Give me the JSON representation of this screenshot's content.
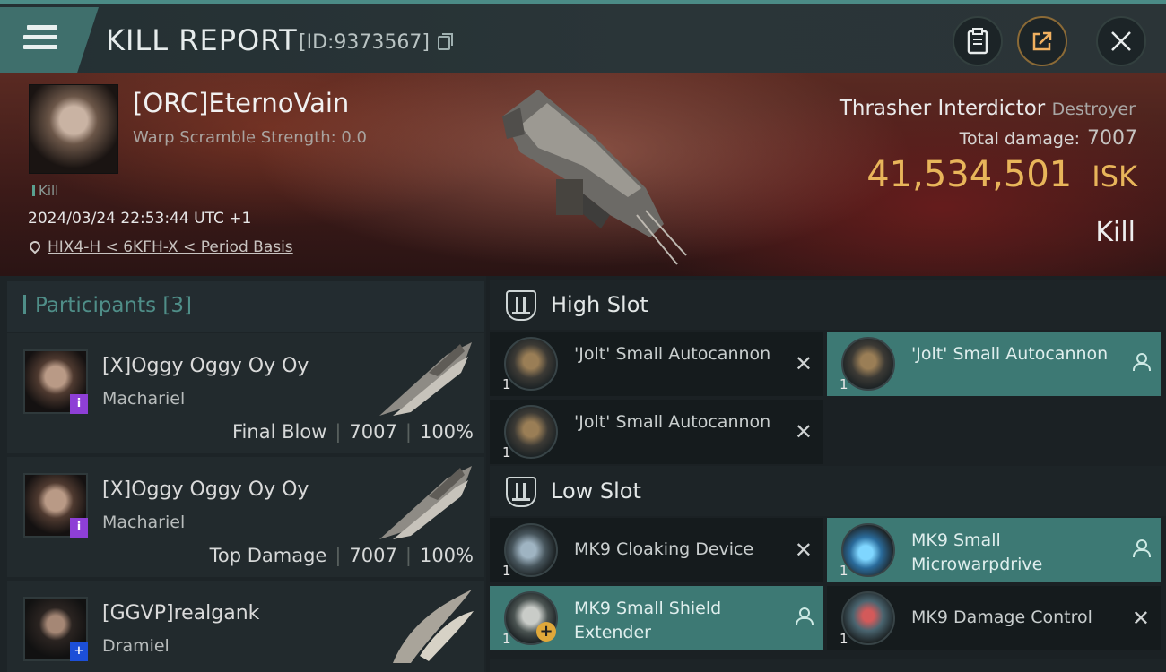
{
  "header": {
    "title": "KILL REPORT",
    "id_label": "[ID:9373567]",
    "icons": [
      "menu-icon",
      "copy-icon",
      "clipboard-icon",
      "share-icon",
      "close-icon"
    ]
  },
  "victim": {
    "pilot_name": "[ORC]EternoVain",
    "warp_scramble": "Warp Scramble Strength: 0.0",
    "kill_tag": "Kill",
    "datetime": "2024/03/24 22:53:44 UTC +1",
    "location": "HIX4-H < 6KFH-X < Period Basis",
    "ship_name": "Thrasher Interdictor",
    "ship_class": "Destroyer",
    "total_damage_label": "Total damage:",
    "total_damage_value": "7007",
    "isk_value": "41,534,501",
    "isk_unit": "ISK",
    "result": "Kill"
  },
  "participants": {
    "title": "Participants",
    "count": "[3]",
    "items": [
      {
        "name": "[X]Oggy Oggy Oy Oy",
        "ship": "Machariel",
        "role": "Final Blow",
        "damage": "7007",
        "percent": "100%",
        "badge": "i"
      },
      {
        "name": "[X]Oggy Oggy Oy Oy",
        "ship": "Machariel",
        "role": "Top Damage",
        "damage": "7007",
        "percent": "100%",
        "badge": "i"
      },
      {
        "name": "[GGVP]realgank",
        "ship": "Dramiel",
        "role": "",
        "damage": "",
        "percent": "",
        "badge": "+"
      }
    ]
  },
  "fitting": {
    "high_slot_title": "High Slot",
    "low_slot_title": "Low Slot",
    "high": [
      {
        "name": "'Jolt' Small Autocannon",
        "qty": "1",
        "status": "destroyed"
      },
      {
        "name": "'Jolt' Small Autocannon",
        "qty": "1",
        "status": "dropped"
      },
      {
        "name": "'Jolt' Small Autocannon",
        "qty": "1",
        "status": "destroyed"
      }
    ],
    "low": [
      {
        "name": "MK9 Cloaking Device",
        "qty": "1",
        "status": "destroyed"
      },
      {
        "name": "MK9 Small Microwarpdrive",
        "qty": "1",
        "status": "dropped"
      },
      {
        "name": "MK9 Small Shield Extender",
        "qty": "1",
        "status": "dropped"
      },
      {
        "name": "MK9 Damage Control",
        "qty": "1",
        "status": "destroyed"
      }
    ]
  }
}
